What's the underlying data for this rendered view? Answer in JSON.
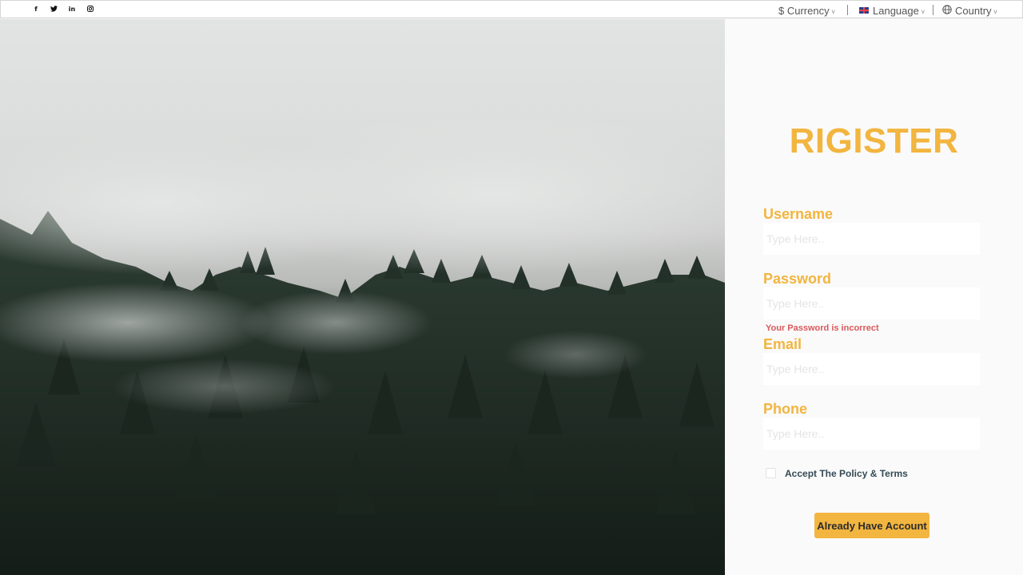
{
  "topbar": {
    "social": [
      {
        "icon": "facebook-icon",
        "glyph": "f"
      },
      {
        "icon": "twitter-icon"
      },
      {
        "icon": "linkedin-icon",
        "glyph": "in"
      },
      {
        "icon": "instagram-icon"
      }
    ],
    "currency_label": "$ Currency",
    "language_label": "Language",
    "country_label": "Country",
    "chevron": "v"
  },
  "hero": {
    "description_icon": "forest-fog-photo"
  },
  "form": {
    "title": "RIGISTER",
    "username": {
      "label": "Username",
      "placeholder": "Type Here..",
      "value": ""
    },
    "password": {
      "label": "Password",
      "placeholder": "Type Here..",
      "value": "",
      "error": "Your Password is incorrect"
    },
    "email": {
      "label": "Email",
      "placeholder": "Type Here..",
      "value": ""
    },
    "phone": {
      "label": "Phone",
      "placeholder": "Type Here..",
      "value": ""
    },
    "accept_label": "Accept The Policy & Terms",
    "accept_checked": false,
    "button_label": "Already Have Account"
  },
  "colors": {
    "accent": "#f2b53f",
    "error": "#d9595c",
    "panel_bg": "#fafafa"
  }
}
